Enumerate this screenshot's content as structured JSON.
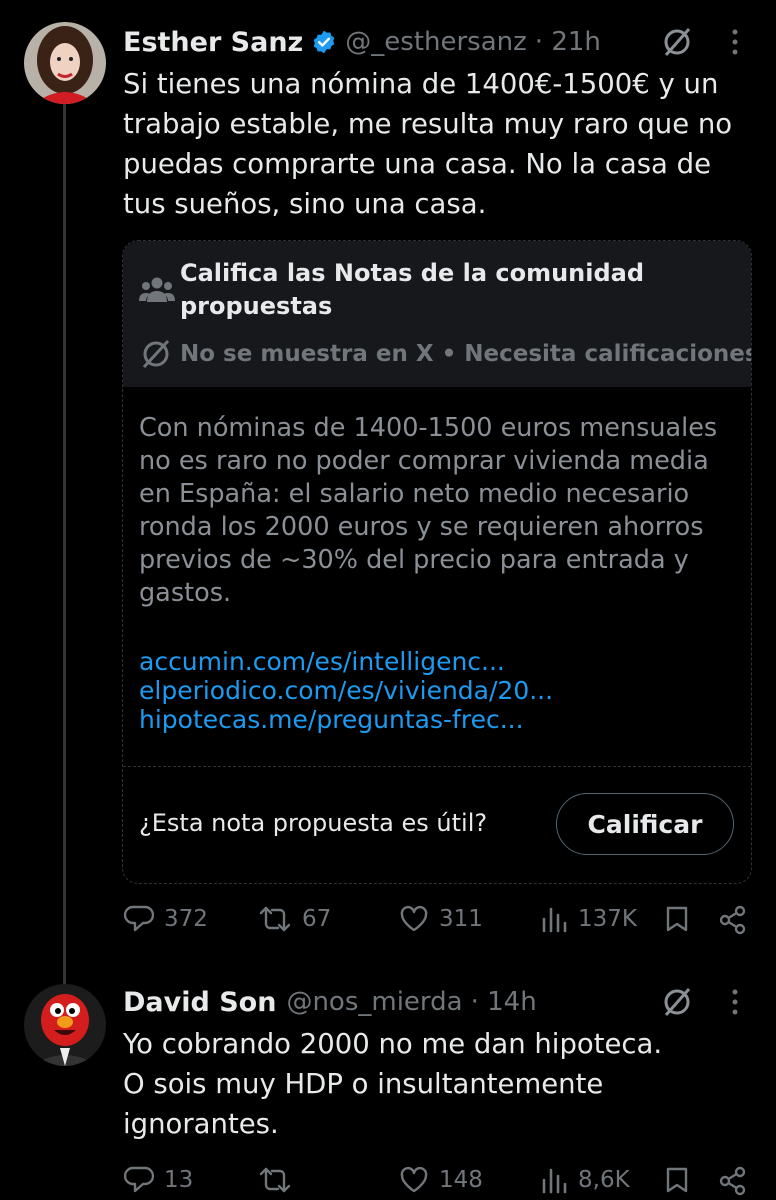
{
  "tweet1": {
    "name": "Esther Sanz",
    "handle": "@_esthersanz",
    "time": "· 21h",
    "text": [
      "Si tienes una nómina de 1400€-1500€ y un",
      "trabajo estable, me resulta muy raro que no",
      "puedas comprarte una casa. No la casa de",
      "tus sueños, sino una casa."
    ],
    "note": {
      "title_lines": [
        "Califica las Notas de la comunidad",
        "propuestas"
      ],
      "status": "No se muestra en X • Necesita calificaciones",
      "body_lines": [
        "Con nóminas de 1400-1500 euros mensuales",
        "no es raro no poder comprar vivienda media",
        "en España: el salario neto medio necesario",
        "ronda los 2000 euros y se requieren ahorros",
        "previos de ~30% del precio para entrada y",
        "gastos."
      ],
      "links": [
        "accumin.com/es/intelligenc...",
        "elperiodico.com/es/vivienda/20...",
        "hipotecas.me/preguntas-frec..."
      ],
      "question": "¿Esta nota propuesta es útil?",
      "button": "Calificar"
    },
    "stats": {
      "replies": "372",
      "reposts": "67",
      "likes": "311",
      "views": "137K"
    }
  },
  "tweet2": {
    "name": "David Son",
    "handle": "@nos_mierda",
    "time": "· 14h",
    "text": [
      "Yo cobrando 2000 no me dan hipoteca.",
      "O sois muy HDP o insultantemente",
      "ignorantes."
    ],
    "stats": {
      "replies": "13",
      "reposts": "",
      "likes": "148",
      "views": "8,6K"
    }
  },
  "colors": {
    "verified": "#1d9bf0",
    "link": "#1d9bf0",
    "muted": "#71767b"
  }
}
